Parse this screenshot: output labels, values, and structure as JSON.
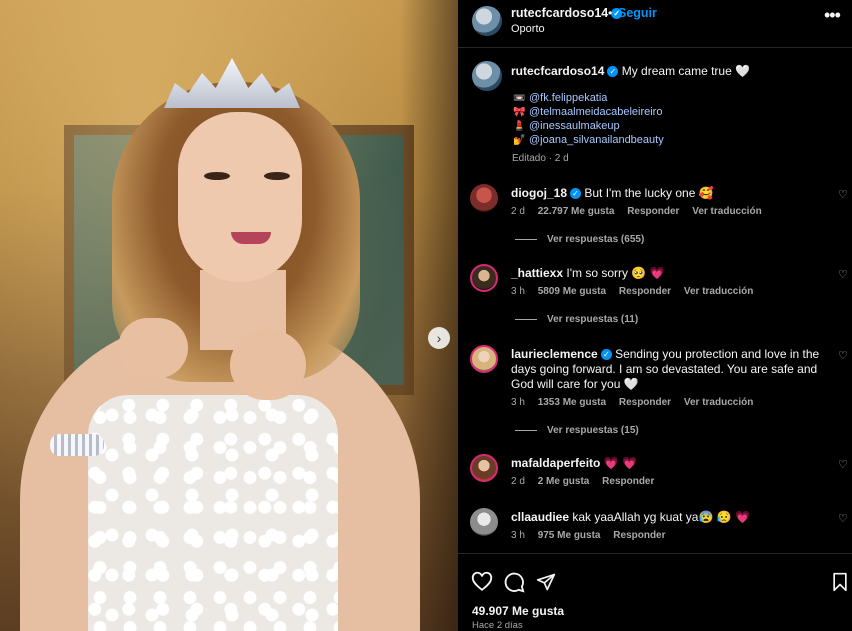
{
  "post": {
    "username": "rutecfcardoso14",
    "follow_label": "Seguir",
    "location": "Oporto",
    "dot": "•",
    "more_label": "•••"
  },
  "caption": {
    "username": "rutecfcardoso14",
    "text": "My dream came true 🤍",
    "tags": [
      {
        "icon": "📼",
        "handle": "@fk.felippekatia"
      },
      {
        "icon": "🎀",
        "handle": "@telmaalmeidacabeleireiro"
      },
      {
        "icon": "💄",
        "handle": "@inessaulmakeup"
      },
      {
        "icon": "💅",
        "handle": "@joana_silvanailandbeauty"
      }
    ],
    "edited": "Editado · 2 d"
  },
  "comments": [
    {
      "username": "diogoj_18",
      "verified": true,
      "text": "But I'm the lucky one 🥰",
      "time": "2 d",
      "likes": "22.797 Me gusta",
      "reply": "Responder",
      "translate": "Ver traducción",
      "replies": "Ver respuestas (655)"
    },
    {
      "username": "_hattiexx",
      "verified": false,
      "text": "I'm so sorry 🥺 💗",
      "time": "3 h",
      "likes": "5809 Me gusta",
      "reply": "Responder",
      "translate": "Ver traducción",
      "replies": "Ver respuestas (11)"
    },
    {
      "username": "laurieclemence",
      "verified": true,
      "text": "Sending you protection and love in the days going forward. I am so devastated. You are safe and God will care for you 🤍",
      "time": "3 h",
      "likes": "1353 Me gusta",
      "reply": "Responder",
      "translate": "Ver traducción",
      "replies": "Ver respuestas (15)"
    },
    {
      "username": "mafaldaperfeito",
      "verified": false,
      "text": "💗 💗",
      "time": "2 d",
      "likes": "2 Me gusta",
      "reply": "Responder"
    },
    {
      "username": "cllaaudiee",
      "verified": false,
      "text": "kak yaaAllah yg kuat ya😰 😥 💗",
      "time": "3 h",
      "likes": "975 Me gusta",
      "reply": "Responder"
    }
  ],
  "footer": {
    "likes": "49.907 Me gusta",
    "time": "Hace 2 días"
  },
  "icons": {
    "heart": "heart-icon",
    "comment": "comment-icon",
    "share": "share-icon",
    "bookmark": "bookmark-icon"
  },
  "colors": {
    "background": "#000000",
    "link": "#0095f6",
    "muted": "#a8a8a8"
  }
}
